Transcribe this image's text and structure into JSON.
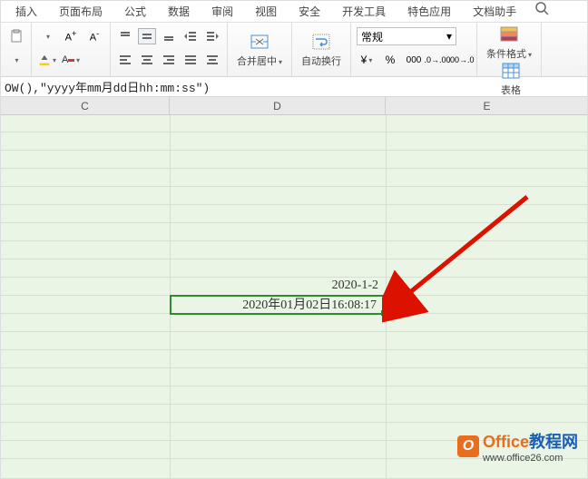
{
  "tabs": {
    "insert": "插入",
    "page_layout": "页面布局",
    "formula": "公式",
    "data": "数据",
    "review": "审阅",
    "view": "视图",
    "security": "安全",
    "dev_tools": "开发工具",
    "special": "特色应用",
    "doc_helper": "文档助手"
  },
  "toolbar": {
    "merge_label": "合并居中",
    "wrap_label": "自动换行",
    "numfmt_selected": "常规",
    "cond_label": "条件格式",
    "table_label": "表格"
  },
  "formula_bar": {
    "content": "OW(),\"yyyy年mm月dd日hh:mm:ss\")"
  },
  "columns": {
    "c": "C",
    "d": "D",
    "e": "E"
  },
  "cells": {
    "d10": "2020-1-2",
    "d11": "2020年01月02日16:08:17"
  },
  "watermark": {
    "brand_o": "Office",
    "brand_rest": "教程网",
    "url": "www.office26.com"
  },
  "colors": {
    "accent_orange": "#e86d1f",
    "selection_green": "#2e8b2e",
    "sheet_bg": "#eaf5e6"
  }
}
